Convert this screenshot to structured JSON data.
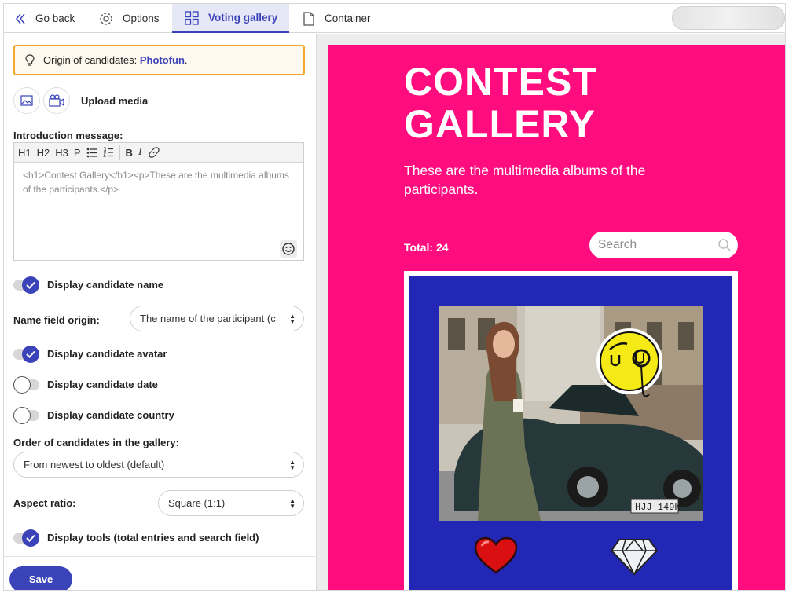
{
  "topbar": {
    "tabs": [
      {
        "label": "Go back",
        "icon": "chevron-double-left-icon"
      },
      {
        "label": "Options",
        "icon": "gear-icon"
      },
      {
        "label": "Voting gallery",
        "icon": "grid-icon",
        "active": true
      },
      {
        "label": "Container",
        "icon": "document-icon"
      }
    ]
  },
  "sidebar": {
    "origin_prefix": "Origin of candidates:",
    "origin_link": "Photofun",
    "origin_suffix": ".",
    "upload_label": "Upload media",
    "intro_label": "Introduction message:",
    "toolbar": [
      "H1",
      "H2",
      "H3",
      "P",
      "B",
      "I"
    ],
    "intro_value": "<h1>Contest Gallery</h1><p>These are the multimedia albums of the participants.</p>",
    "toggle_display_name": {
      "label": "Display candidate name",
      "on": true
    },
    "name_field_label": "Name field origin:",
    "name_field_value": "The name of the participant (c",
    "toggle_avatar": {
      "label": "Display candidate avatar",
      "on": true
    },
    "toggle_date": {
      "label": "Display candidate date",
      "on": false
    },
    "toggle_country": {
      "label": "Display candidate country",
      "on": false
    },
    "order_label": "Order of candidates in the gallery:",
    "order_value": "From newest to oldest (default)",
    "aspect_label": "Aspect ratio:",
    "aspect_value": "Square (1:1)",
    "toggle_tools": {
      "label": "Display tools (total entries and search field)",
      "on": true
    },
    "save_label": "Save"
  },
  "preview": {
    "background": "#ff0d7f",
    "title_line1": "CONTEST",
    "title_line2": "GALLERY",
    "subtitle": "These are the multimedia albums of the participants.",
    "total_label": "Total: 24",
    "search_placeholder": "Search",
    "card_background": "#2227b6",
    "plate_text": "HJJ 149K"
  },
  "colors": {
    "accent": "#3a43b8",
    "warning_border": "#f3a72d"
  }
}
